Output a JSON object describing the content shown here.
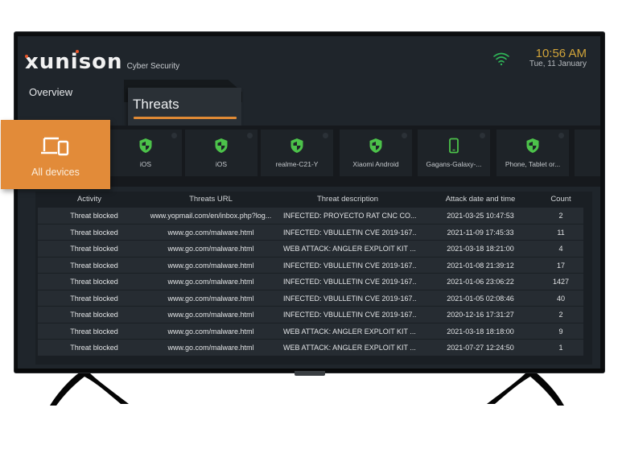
{
  "brand": {
    "logo": "xunison",
    "subtitle": "Cyber Security"
  },
  "status": {
    "wifi_icon": "wifi-icon",
    "wifi_color": "#2fb457",
    "time": "10:56 AM",
    "date": "Tue, 11 January"
  },
  "nav": {
    "overview": "Overview",
    "threats": "Threats",
    "accent": "#e08a35"
  },
  "devices": {
    "selected": {
      "label": "All devices",
      "icon": "devices-icon",
      "color": "#e28b39"
    },
    "items": [
      {
        "label": "iOS",
        "icon": "shield-icon"
      },
      {
        "label": "iOS",
        "icon": "shield-icon"
      },
      {
        "label": "realme-C21-Y",
        "icon": "shield-icon"
      },
      {
        "label": "Xiaomi Android",
        "icon": "shield-icon"
      },
      {
        "label": "Gagans-Galaxy-...",
        "icon": "smartphone-icon"
      },
      {
        "label": "Phone, Tablet or...",
        "icon": "shield-icon"
      },
      {
        "label": "",
        "icon": ""
      }
    ],
    "icon_color": "#4cc24a"
  },
  "table": {
    "headers": [
      "Activity",
      "Threats URL",
      "Threat description",
      "Attack date and time",
      "Count"
    ],
    "rows": [
      [
        "Threat blocked",
        "www.yopmail.com/en/inbox.php?log...",
        "INFECTED: PROYECTO RAT CNC CO...",
        "2021-03-25 10:47:53",
        "2"
      ],
      [
        "Threat blocked",
        "www.go.com/malware.html",
        "INFECTED: VBULLETIN CVE 2019-167...",
        "2021-11-09 17:45:33",
        "11"
      ],
      [
        "Threat blocked",
        "www.go.com/malware.html",
        "WEB ATTACK: ANGLER EXPLOIT KIT ...",
        "2021-03-18 18:21:00",
        "4"
      ],
      [
        "Threat blocked",
        "www.go.com/malware.html",
        "INFECTED: VBULLETIN CVE 2019-167...",
        "2021-01-08 21:39:12",
        "17"
      ],
      [
        "Threat blocked",
        "www.go.com/malware.html",
        "INFECTED: VBULLETIN CVE 2019-167...",
        "2021-01-06 23:06:22",
        "1427"
      ],
      [
        "Threat blocked",
        "www.go.com/malware.html",
        "INFECTED: VBULLETIN CVE 2019-167...",
        "2021-01-05 02:08:46",
        "40"
      ],
      [
        "Threat blocked",
        "www.go.com/malware.html",
        "INFECTED: VBULLETIN CVE 2019-167...",
        "2020-12-16 17:31:27",
        "2"
      ],
      [
        "Threat blocked",
        "www.go.com/malware.html",
        "WEB ATTACK: ANGLER EXPLOIT KIT ...",
        "2021-03-18 18:18:00",
        "9"
      ],
      [
        "Threat blocked",
        "www.go.com/malware.html",
        "WEB ATTACK: ANGLER EXPLOIT KIT ...",
        "2021-07-27 12:24:50",
        "1"
      ]
    ]
  }
}
